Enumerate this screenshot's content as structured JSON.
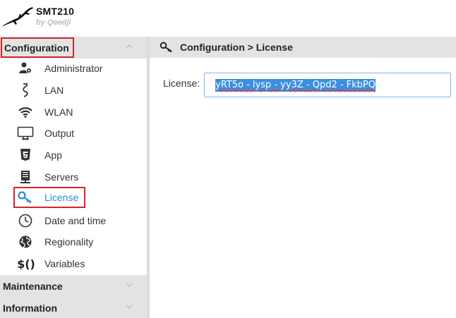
{
  "app": {
    "title": "SMT210",
    "subtitle": "by Qeedji"
  },
  "sidebar": {
    "sections": [
      {
        "label": "Configuration",
        "expanded": true
      },
      {
        "label": "Maintenance",
        "expanded": false
      },
      {
        "label": "Information",
        "expanded": false
      }
    ],
    "items": [
      {
        "label": "Administrator",
        "icon": "administrator-icon"
      },
      {
        "label": "LAN",
        "icon": "lan-cable-icon"
      },
      {
        "label": "WLAN",
        "icon": "wifi-icon"
      },
      {
        "label": "Output",
        "icon": "monitor-icon"
      },
      {
        "label": "App",
        "icon": "html5-icon"
      },
      {
        "label": "Servers",
        "icon": "server-icon"
      },
      {
        "label": "License",
        "icon": "key-icon",
        "active": true
      },
      {
        "label": "Date and time",
        "icon": "clock-icon"
      },
      {
        "label": "Regionality",
        "icon": "globe-icon"
      },
      {
        "label": "Variables",
        "icon": "variables-icon"
      }
    ]
  },
  "main": {
    "breadcrumb": "Configuration > License",
    "license_label": "License:",
    "license_value": "yRT5o - lysp - yy3Z - Qpd2 - FkbPQ"
  },
  "colors": {
    "highlight_border": "#d3262b",
    "active_text": "#2a8ad8",
    "header_bg": "#e3e3e3",
    "selection_bg": "#3b8fe0"
  }
}
